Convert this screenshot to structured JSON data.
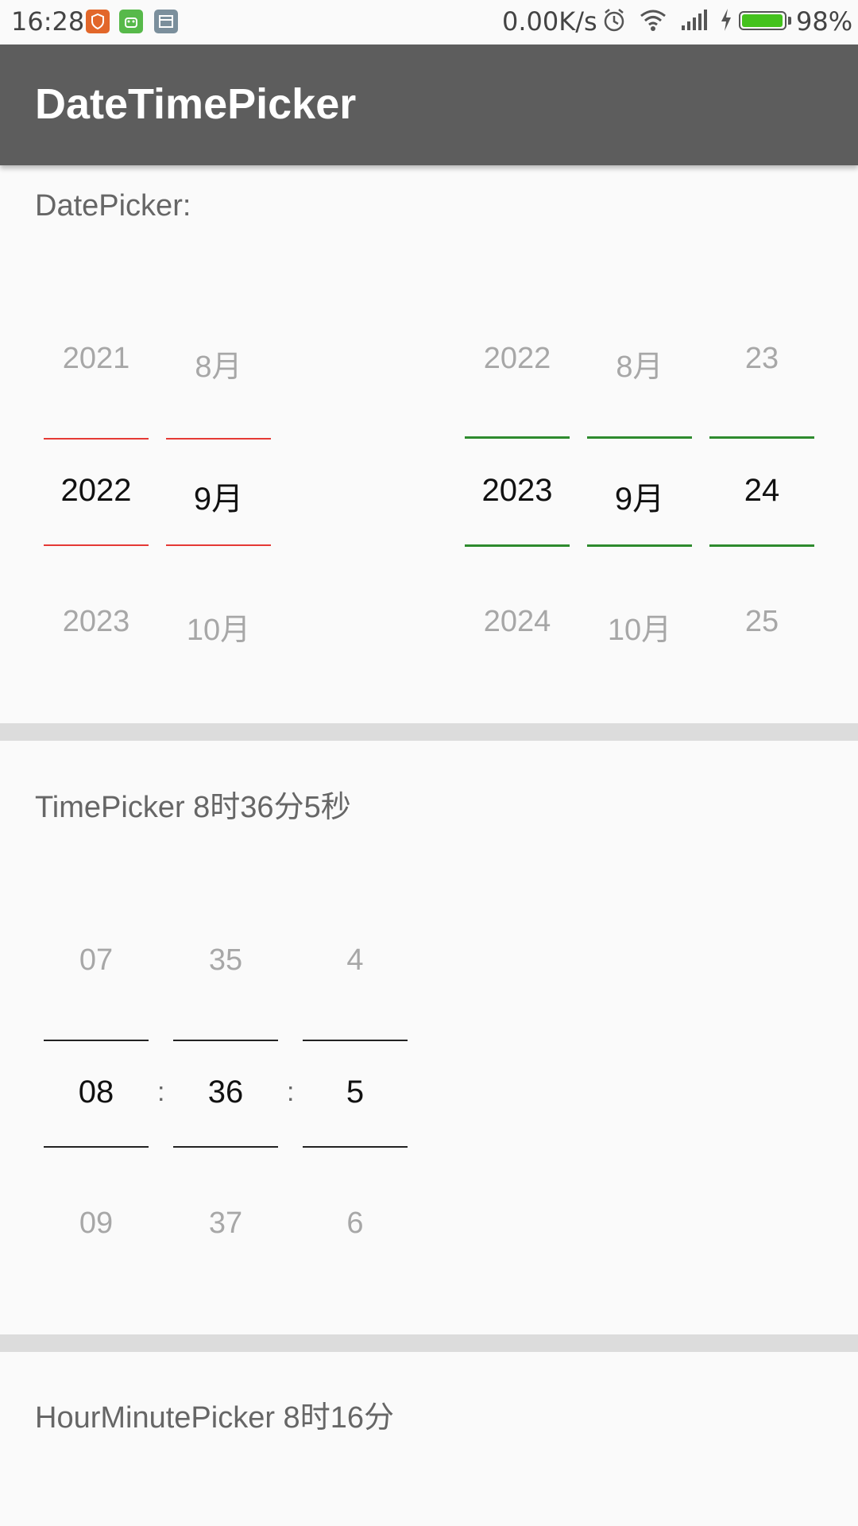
{
  "status_bar": {
    "time": "16:28",
    "net_speed": "0.00K/s",
    "battery": "98%",
    "battery_level": 0.98,
    "app_icons": [
      {
        "name": "shield-app-icon",
        "color": "#e2672a"
      },
      {
        "name": "android-app-icon",
        "color": "#57b94a"
      },
      {
        "name": "image-app-icon",
        "color": "#7b8f9c"
      }
    ],
    "icons": [
      "alarm-icon",
      "wifi-icon",
      "signal-icon",
      "charging-icon",
      "battery-icon"
    ],
    "battery_color": "#44c21d"
  },
  "app_bar": {
    "title": "DateTimePicker",
    "color": "#5d5d5d"
  },
  "date_picker": {
    "label": "DatePicker:",
    "left": {
      "divider_color": "#e53935",
      "year": {
        "prev": "2021",
        "selected": "2022",
        "next": "2023"
      },
      "month": {
        "prev": "8月",
        "selected": "9月",
        "next": "10月"
      }
    },
    "right": {
      "divider_color": "#2e8b2e",
      "year": {
        "prev": "2022",
        "selected": "2023",
        "next": "2024"
      },
      "month": {
        "prev": "8月",
        "selected": "9月",
        "next": "10月"
      },
      "day": {
        "prev": "23",
        "selected": "24",
        "next": "25"
      }
    }
  },
  "time_picker": {
    "label": "TimePicker  8时36分5秒",
    "separator": ":",
    "divider_color": "#222222",
    "hour": {
      "prev": "07",
      "selected": "08",
      "next": "09"
    },
    "minute": {
      "prev": "35",
      "selected": "36",
      "next": "37"
    },
    "second": {
      "prev": "4",
      "selected": "5",
      "next": "6"
    }
  },
  "hour_minute_picker": {
    "label": "HourMinutePicker  8时16分"
  }
}
